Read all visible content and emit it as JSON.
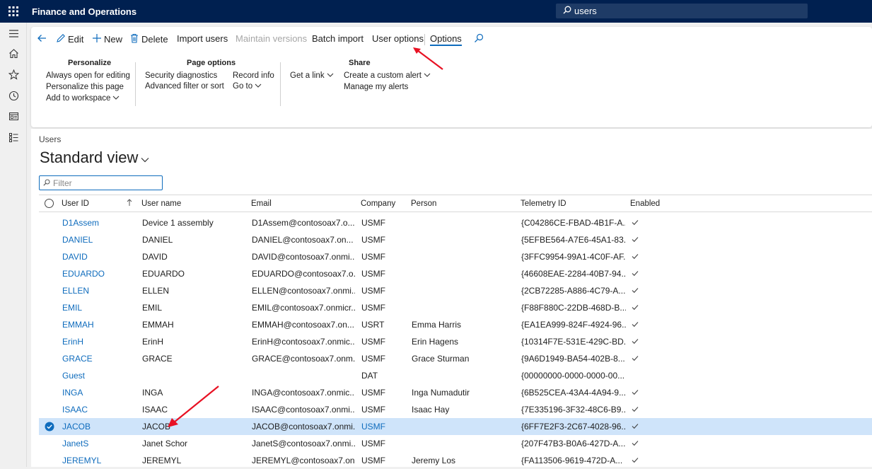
{
  "app": {
    "title": "Finance and Operations",
    "search_value": "users"
  },
  "toolbar": {
    "edit": "Edit",
    "new": "New",
    "delete": "Delete",
    "import_users": "Import users",
    "maintain_versions": "Maintain versions",
    "batch_import": "Batch import",
    "user_options": "User options",
    "options": "Options"
  },
  "ribbon": {
    "personalize": {
      "title": "Personalize",
      "items": [
        "Always open for editing",
        "Personalize this page",
        "Add to workspace"
      ]
    },
    "page_options": {
      "title": "Page options",
      "items": [
        "Security diagnostics",
        "Advanced filter or sort",
        "Record info",
        "Go to"
      ]
    },
    "share": {
      "title": "Share",
      "items": [
        "Get a link",
        "Create a custom alert",
        "Manage my alerts"
      ]
    }
  },
  "page": {
    "breadcrumb": "Users",
    "view_name": "Standard view",
    "filter_placeholder": "Filter"
  },
  "grid": {
    "columns": [
      "User ID",
      "User name",
      "Email",
      "Company",
      "Person",
      "Telemetry ID",
      "Enabled"
    ],
    "rows": [
      {
        "user_id": "D1Assem",
        "user_name": "Device 1 assembly",
        "email": "D1Assem@contosoax7.o...",
        "company": "USMF",
        "person": "",
        "telemetry": "{C04286CE-FBAD-4B1F-A...",
        "enabled": true
      },
      {
        "user_id": "DANIEL",
        "user_name": "DANIEL",
        "email": "DANIEL@contosoax7.on...",
        "company": "USMF",
        "person": "",
        "telemetry": "{5EFBE564-A7E6-45A1-83...",
        "enabled": true
      },
      {
        "user_id": "DAVID",
        "user_name": "DAVID",
        "email": "DAVID@contosoax7.onmi...",
        "company": "USMF",
        "person": "",
        "telemetry": "{3FFC9954-99A1-4C0F-AF...",
        "enabled": true
      },
      {
        "user_id": "EDUARDO",
        "user_name": "EDUARDO",
        "email": "EDUARDO@contosoax7.o...",
        "company": "USMF",
        "person": "",
        "telemetry": "{46608EAE-2284-40B7-94...",
        "enabled": true
      },
      {
        "user_id": "ELLEN",
        "user_name": "ELLEN",
        "email": "ELLEN@contosoax7.onmi...",
        "company": "USMF",
        "person": "",
        "telemetry": "{2CB72285-A886-4C79-A...",
        "enabled": true
      },
      {
        "user_id": "EMIL",
        "user_name": "EMIL",
        "email": "EMIL@contosoax7.onmicr...",
        "company": "USMF",
        "person": "",
        "telemetry": "{F88F880C-22DB-468D-B...",
        "enabled": true
      },
      {
        "user_id": "EMMAH",
        "user_name": "EMMAH",
        "email": "EMMAH@contosoax7.on...",
        "company": "USRT",
        "person": "Emma Harris",
        "telemetry": "{EA1EA999-824F-4924-96...",
        "enabled": true
      },
      {
        "user_id": "ErinH",
        "user_name": "ErinH",
        "email": "ErinH@contosoax7.onmic...",
        "company": "USMF",
        "person": "Erin Hagens",
        "telemetry": "{10314F7E-531E-429C-BD...",
        "enabled": true
      },
      {
        "user_id": "GRACE",
        "user_name": "GRACE",
        "email": "GRACE@contosoax7.onm...",
        "company": "USMF",
        "person": "Grace Sturman",
        "telemetry": "{9A6D1949-BA54-402B-8...",
        "enabled": true
      },
      {
        "user_id": "Guest",
        "user_name": "",
        "email": "",
        "company": "DAT",
        "person": "",
        "telemetry": "{00000000-0000-0000-00...",
        "enabled": false
      },
      {
        "user_id": "INGA",
        "user_name": "INGA",
        "email": "INGA@contosoax7.onmic...",
        "company": "USMF",
        "person": "Inga Numadutir",
        "telemetry": "{6B525CEA-43A4-4A94-9...",
        "enabled": true
      },
      {
        "user_id": "ISAAC",
        "user_name": "ISAAC",
        "email": "ISAAC@contosoax7.onmi...",
        "company": "USMF",
        "person": "Isaac Hay",
        "telemetry": "{7E335196-3F32-48C6-B9...",
        "enabled": true
      },
      {
        "user_id": "JACOB",
        "user_name": "JACOB",
        "email": "JACOB@contosoax7.onmi...",
        "company": "USMF",
        "person": "",
        "telemetry": "{6FF7E2F3-2C67-4028-96...",
        "enabled": true,
        "selected": true
      },
      {
        "user_id": "JanetS",
        "user_name": "Janet Schor",
        "email": "JanetS@contosoax7.onmi...",
        "company": "USMF",
        "person": "",
        "telemetry": "{207F47B3-B0A6-427D-A...",
        "enabled": true
      },
      {
        "user_id": "JEREMYL",
        "user_name": "JEREMYL",
        "email": "JEREMYL@contosoax7.on...",
        "company": "USMF",
        "person": "Jeremy Los",
        "telemetry": "{FA113506-9619-472D-A...",
        "enabled": true
      }
    ]
  },
  "colors": {
    "topbar": "#002050",
    "accent": "#0f6cbd",
    "selected_row": "#cfe4fa",
    "annotation_arrow": "#e81123"
  }
}
